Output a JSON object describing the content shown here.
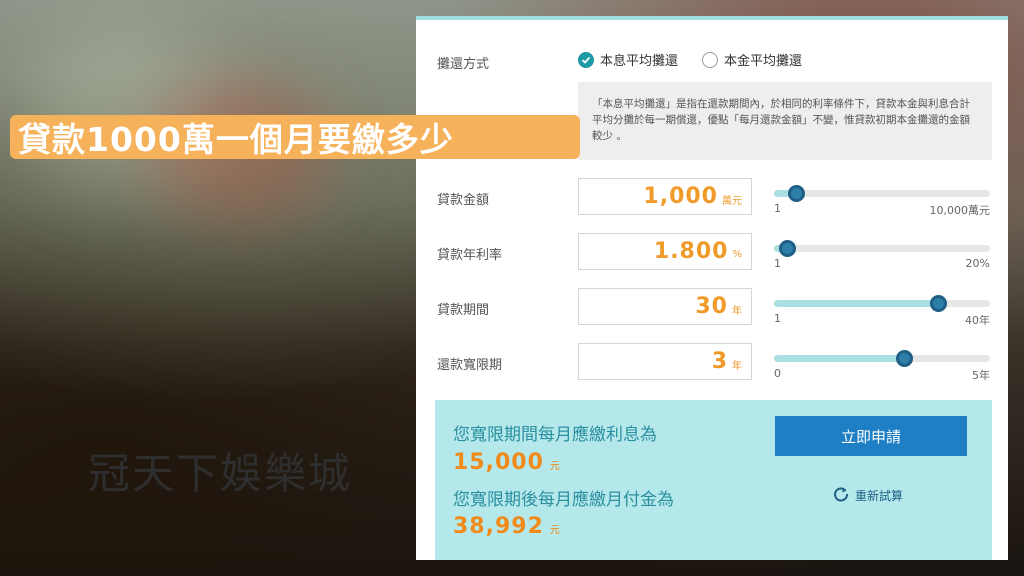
{
  "headline": "貸款1000萬一個月要繳多少",
  "watermark": "冠天下娛樂城",
  "calculator": {
    "repay_method_label": "攤還方式",
    "repay_options": [
      {
        "label": "本息平均攤還",
        "checked": true
      },
      {
        "label": "本金平均攤還",
        "checked": false
      }
    ],
    "description": "「本息平均攤還」是指在還款期間內，於相同的利率條件下，貸款本金與利息合計平均分攤於每一期償還，優點「每月還款金額」不變，惟貸款初期本金攤還的金額較少 。",
    "fields": [
      {
        "label": "貸款金額",
        "value": "1,000",
        "unit": "萬元",
        "slider_min": "1",
        "slider_max": "10,000萬元",
        "slider_fraction": 0.1
      },
      {
        "label": "貸款年利率",
        "value": "1.800",
        "unit": "%",
        "slider_min": "1",
        "slider_max": "20%",
        "slider_fraction": 0.06
      },
      {
        "label": "貸款期間",
        "value": "30",
        "unit": "年",
        "slider_min": "1",
        "slider_max": "40年",
        "slider_fraction": 0.76
      },
      {
        "label": "還款寬限期",
        "value": "3",
        "unit": "年",
        "slider_min": "0",
        "slider_max": "5年",
        "slider_fraction": 0.6
      }
    ],
    "result": {
      "grace_label": "您寬限期間每月應繳利息為",
      "grace_amount": "15,000",
      "after_label": "您寬限期後每月應繳月付金為",
      "after_amount": "38,992",
      "currency_unit": "元",
      "apply_button": "立即申請",
      "recalc_label": "重新試算"
    }
  },
  "colors": {
    "accent_orange": "#f09a2a",
    "teal": "#1d9aa6",
    "result_bg": "#b5e8ea",
    "button_blue": "#1f7fc4"
  }
}
